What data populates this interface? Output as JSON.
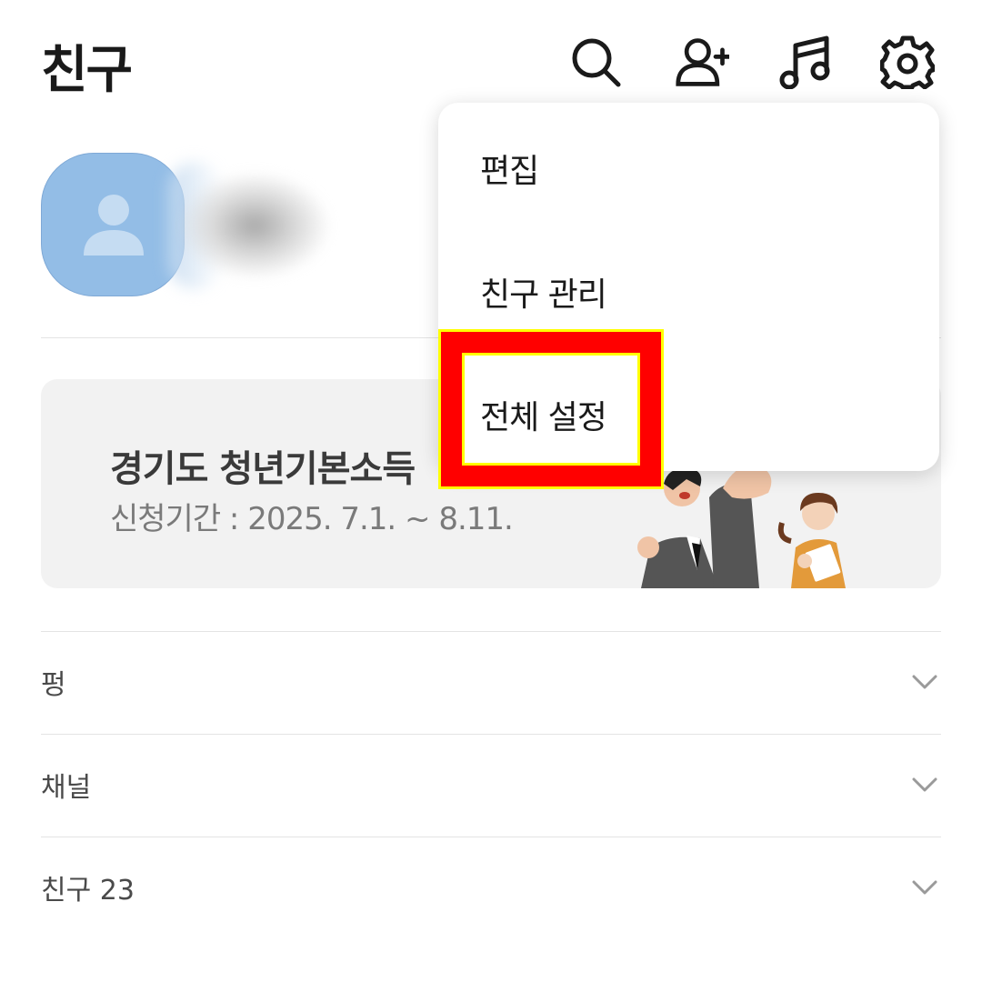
{
  "header": {
    "title": "친구",
    "icons": [
      "search-icon",
      "add-friend-icon",
      "music-icon",
      "settings-icon"
    ]
  },
  "banner": {
    "title": "경기도 청년기본소득",
    "subtitle": "신청기간 : 2025. 7.1. ~ 8.11."
  },
  "menu": {
    "items": [
      "편집",
      "친구 관리",
      "전체 설정"
    ],
    "highlighted": "전체 설정"
  },
  "sections": [
    {
      "label": "펑"
    },
    {
      "label": "채널"
    },
    {
      "label": "친구 23"
    }
  ],
  "colors": {
    "highlight_box": "#ff0000",
    "highlight_border": "#ffff00",
    "avatar_bg": "#93bde6",
    "banner_bg": "#f2f2f2"
  }
}
